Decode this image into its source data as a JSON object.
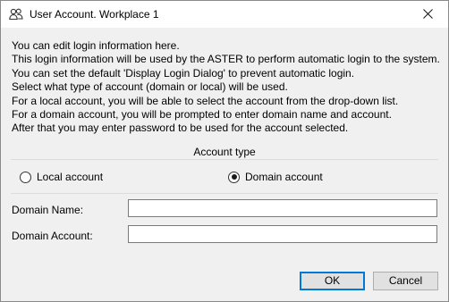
{
  "window": {
    "title": "User Account. Workplace 1",
    "icon": "users-icon",
    "close_icon": "close-icon"
  },
  "description": [
    "You can edit login information here.",
    "This login information will be used by the ASTER to perform automatic login to the system.",
    "You can set the default 'Display Login Dialog' to prevent automatic login.",
    "Select what type of account (domain or local) will be used.",
    "For a local account, you will be able to select the account from the drop-down list.",
    "For a domain account, you will be prompted to enter domain name and account.",
    "After that you may enter password to be used for the account selected."
  ],
  "account_type": {
    "title": "Account type",
    "options": [
      {
        "label": "Local account",
        "selected": false
      },
      {
        "label": "Domain account",
        "selected": true
      }
    ]
  },
  "fields": {
    "domain_name": {
      "label": "Domain Name:",
      "value": ""
    },
    "domain_account": {
      "label": "Domain Account:",
      "value": ""
    }
  },
  "buttons": {
    "ok": "OK",
    "cancel": "Cancel"
  },
  "colors": {
    "accent": "#0078d7",
    "dialog_bg": "#f0f0f0"
  }
}
